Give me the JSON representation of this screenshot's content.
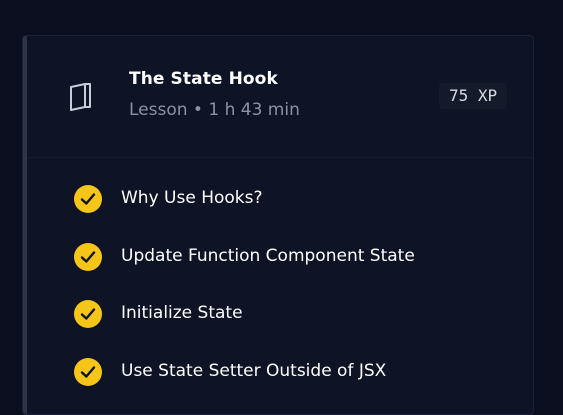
{
  "lesson": {
    "title": "The State Hook",
    "meta": "Lesson • 1 h 43 min",
    "xp": "75 XP",
    "icon": "book-icon"
  },
  "items": [
    {
      "label": "Why Use Hooks?",
      "completed": true
    },
    {
      "label": "Update Function Component State",
      "completed": true
    },
    {
      "label": "Initialize State",
      "completed": true
    },
    {
      "label": "Use State Setter Outside of JSX",
      "completed": true
    }
  ],
  "colors": {
    "background": "#0a0e1f",
    "card": "#0e1325",
    "check": "#f5c518",
    "text": "#ffffff",
    "muted": "#8d91a2"
  }
}
